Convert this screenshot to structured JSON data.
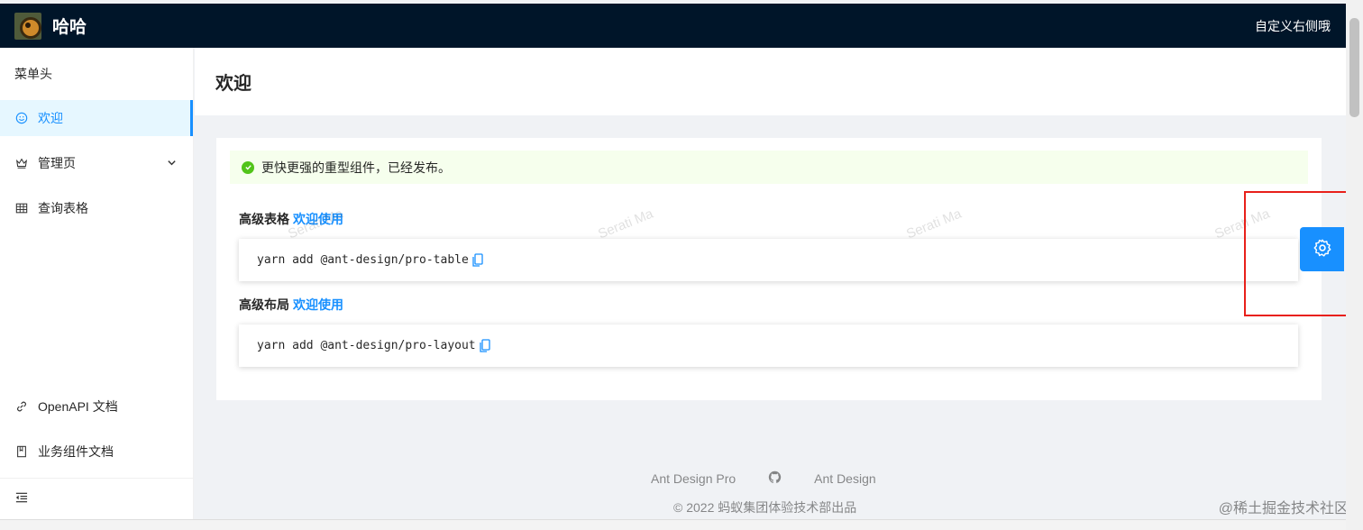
{
  "header": {
    "title": "哈哈",
    "right_text": "自定义右侧哦"
  },
  "sidebar": {
    "menu_header": "菜单头",
    "items": [
      {
        "label": "欢迎",
        "icon": "smile-icon",
        "active": true
      },
      {
        "label": "管理页",
        "icon": "crown-icon",
        "has_submenu": true
      },
      {
        "label": "查询表格",
        "icon": "table-icon"
      }
    ],
    "bottom_links": [
      {
        "label": "OpenAPI 文档",
        "icon": "link-icon"
      },
      {
        "label": "业务组件文档",
        "icon": "book-icon"
      }
    ],
    "collapse_icon": "menu-fold-icon"
  },
  "page": {
    "title": "欢迎"
  },
  "card": {
    "alert": "更快更强的重型组件，已经发布。",
    "sections": [
      {
        "title": "高级表格",
        "link": "欢迎使用",
        "code": "yarn add @ant-design/pro-table"
      },
      {
        "title": "高级布局",
        "link": "欢迎使用",
        "code": "yarn add @ant-design/pro-layout"
      }
    ],
    "watermark": "Serati Ma"
  },
  "footer": {
    "links": [
      "Ant Design Pro",
      "Ant Design"
    ],
    "copyright": "© 2022 蚂蚁集团体验技术部出品"
  },
  "site_mark": "@稀土掘金技术社区",
  "colors": {
    "primary": "#1890ff",
    "header_bg": "#001529",
    "success": "#52c41a",
    "highlight": "#e8201a"
  }
}
